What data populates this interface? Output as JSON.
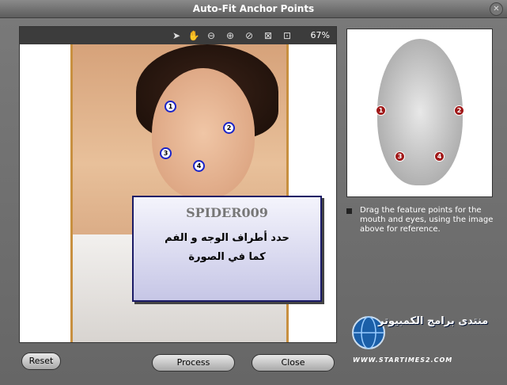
{
  "window": {
    "title": "Auto-Fit Anchor Points"
  },
  "toolbar": {
    "zoom_label": "67%",
    "tools": [
      "pointer-icon",
      "hand-icon",
      "zoom-out-icon",
      "zoom-in-icon",
      "no-icon",
      "fit-icon",
      "actual-size-icon"
    ]
  },
  "overlay": {
    "title": "SPIDER009",
    "line1": "حدد أطراف الوجه و الفم",
    "line2": "كما في الصورة"
  },
  "anchors": [
    "1",
    "2",
    "3",
    "4"
  ],
  "instructions": "Drag the feature points for the mouth and eyes, using the image above for reference.",
  "buttons": {
    "reset": "Reset",
    "process": "Process",
    "close": "Close"
  },
  "watermark": {
    "text": "منتدى برامج الكمبيوتر",
    "url": "WWW.STARTIMES2.COM"
  },
  "colors": {
    "anchor_border": "#1a24c8",
    "ref_point": "#a01818"
  }
}
